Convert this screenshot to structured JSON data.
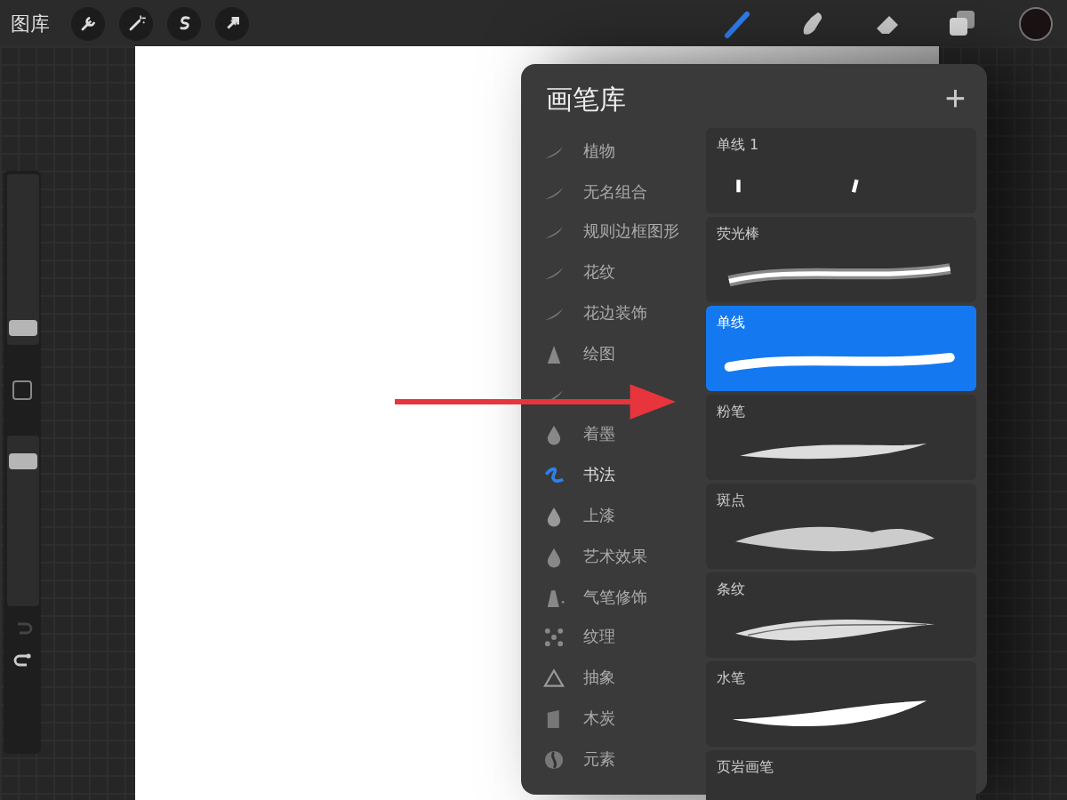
{
  "toolbar": {
    "gallery": "图库",
    "actions": [
      {
        "kind": "wrench"
      },
      {
        "kind": "wand"
      },
      {
        "kind": "select"
      },
      {
        "kind": "move"
      }
    ],
    "tools": [
      {
        "kind": "brush",
        "selected": true
      },
      {
        "kind": "smudge",
        "selected": false
      },
      {
        "kind": "eraser",
        "selected": false
      },
      {
        "kind": "layers",
        "selected": false
      }
    ],
    "color": "#1a1213"
  },
  "sidebar": {
    "size_slider": {
      "level": 0.05
    },
    "opacity_slider": {
      "level": 0.8
    }
  },
  "brush_library": {
    "title": "画笔库",
    "add": "+",
    "sets": [
      {
        "name": "植物",
        "kind": "stroke",
        "selected": false
      },
      {
        "name": "无名组合",
        "kind": "stroke",
        "selected": false
      },
      {
        "name": "规则边框图形",
        "kind": "stroke",
        "selected": false
      },
      {
        "name": "花纹",
        "kind": "stroke",
        "selected": false
      },
      {
        "name": "花边装饰",
        "kind": "stroke",
        "selected": false
      },
      {
        "name": "绘图",
        "kind": "cone",
        "selected": false
      },
      {
        "kind": "stroke",
        "selected": false
      },
      {
        "name": "着墨",
        "kind": "nib",
        "selected": false
      },
      {
        "name": "书法",
        "kind": "stroke",
        "selected": true
      },
      {
        "name": "上漆",
        "kind": "drop",
        "selected": false
      },
      {
        "name": "艺术效果",
        "kind": "nib",
        "selected": false
      },
      {
        "name": "气笔修饰",
        "kind": "spray",
        "selected": false
      },
      {
        "name": "纹理",
        "kind": "dots",
        "selected": false
      },
      {
        "name": "抽象",
        "kind": "triangle",
        "selected": false
      },
      {
        "name": "木炭",
        "kind": "block",
        "selected": false
      },
      {
        "name": "元素",
        "kind": "yin",
        "selected": false
      }
    ],
    "brushes": [
      {
        "name": "单线 1",
        "kind": "ticks",
        "selected": false
      },
      {
        "name": "荧光棒",
        "kind": "glow",
        "selected": false
      },
      {
        "name": "单线",
        "kind": "line",
        "selected": true
      },
      {
        "name": "粉笔",
        "kind": "chalk",
        "selected": false
      },
      {
        "name": "斑点",
        "kind": "blob",
        "selected": false
      },
      {
        "name": "条纹",
        "kind": "stripe",
        "selected": false
      },
      {
        "name": "水笔",
        "kind": "ink",
        "selected": false
      },
      {
        "name": "页岩画笔",
        "kind": "none",
        "selected": false
      }
    ]
  }
}
